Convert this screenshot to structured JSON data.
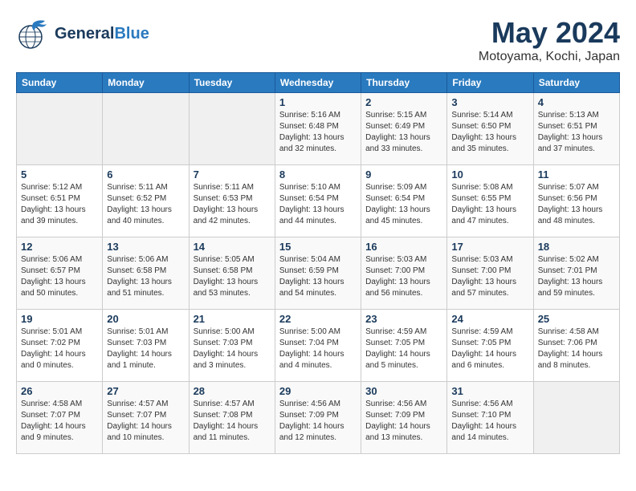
{
  "header": {
    "logo_line1": "General",
    "logo_line2": "Blue",
    "month": "May 2024",
    "location": "Motoyama, Kochi, Japan"
  },
  "weekdays": [
    "Sunday",
    "Monday",
    "Tuesday",
    "Wednesday",
    "Thursday",
    "Friday",
    "Saturday"
  ],
  "weeks": [
    [
      {
        "day": "",
        "info": ""
      },
      {
        "day": "",
        "info": ""
      },
      {
        "day": "",
        "info": ""
      },
      {
        "day": "1",
        "info": "Sunrise: 5:16 AM\nSunset: 6:48 PM\nDaylight: 13 hours\nand 32 minutes."
      },
      {
        "day": "2",
        "info": "Sunrise: 5:15 AM\nSunset: 6:49 PM\nDaylight: 13 hours\nand 33 minutes."
      },
      {
        "day": "3",
        "info": "Sunrise: 5:14 AM\nSunset: 6:50 PM\nDaylight: 13 hours\nand 35 minutes."
      },
      {
        "day": "4",
        "info": "Sunrise: 5:13 AM\nSunset: 6:51 PM\nDaylight: 13 hours\nand 37 minutes."
      }
    ],
    [
      {
        "day": "5",
        "info": "Sunrise: 5:12 AM\nSunset: 6:51 PM\nDaylight: 13 hours\nand 39 minutes."
      },
      {
        "day": "6",
        "info": "Sunrise: 5:11 AM\nSunset: 6:52 PM\nDaylight: 13 hours\nand 40 minutes."
      },
      {
        "day": "7",
        "info": "Sunrise: 5:11 AM\nSunset: 6:53 PM\nDaylight: 13 hours\nand 42 minutes."
      },
      {
        "day": "8",
        "info": "Sunrise: 5:10 AM\nSunset: 6:54 PM\nDaylight: 13 hours\nand 44 minutes."
      },
      {
        "day": "9",
        "info": "Sunrise: 5:09 AM\nSunset: 6:54 PM\nDaylight: 13 hours\nand 45 minutes."
      },
      {
        "day": "10",
        "info": "Sunrise: 5:08 AM\nSunset: 6:55 PM\nDaylight: 13 hours\nand 47 minutes."
      },
      {
        "day": "11",
        "info": "Sunrise: 5:07 AM\nSunset: 6:56 PM\nDaylight: 13 hours\nand 48 minutes."
      }
    ],
    [
      {
        "day": "12",
        "info": "Sunrise: 5:06 AM\nSunset: 6:57 PM\nDaylight: 13 hours\nand 50 minutes."
      },
      {
        "day": "13",
        "info": "Sunrise: 5:06 AM\nSunset: 6:58 PM\nDaylight: 13 hours\nand 51 minutes."
      },
      {
        "day": "14",
        "info": "Sunrise: 5:05 AM\nSunset: 6:58 PM\nDaylight: 13 hours\nand 53 minutes."
      },
      {
        "day": "15",
        "info": "Sunrise: 5:04 AM\nSunset: 6:59 PM\nDaylight: 13 hours\nand 54 minutes."
      },
      {
        "day": "16",
        "info": "Sunrise: 5:03 AM\nSunset: 7:00 PM\nDaylight: 13 hours\nand 56 minutes."
      },
      {
        "day": "17",
        "info": "Sunrise: 5:03 AM\nSunset: 7:00 PM\nDaylight: 13 hours\nand 57 minutes."
      },
      {
        "day": "18",
        "info": "Sunrise: 5:02 AM\nSunset: 7:01 PM\nDaylight: 13 hours\nand 59 minutes."
      }
    ],
    [
      {
        "day": "19",
        "info": "Sunrise: 5:01 AM\nSunset: 7:02 PM\nDaylight: 14 hours\nand 0 minutes."
      },
      {
        "day": "20",
        "info": "Sunrise: 5:01 AM\nSunset: 7:03 PM\nDaylight: 14 hours\nand 1 minute."
      },
      {
        "day": "21",
        "info": "Sunrise: 5:00 AM\nSunset: 7:03 PM\nDaylight: 14 hours\nand 3 minutes."
      },
      {
        "day": "22",
        "info": "Sunrise: 5:00 AM\nSunset: 7:04 PM\nDaylight: 14 hours\nand 4 minutes."
      },
      {
        "day": "23",
        "info": "Sunrise: 4:59 AM\nSunset: 7:05 PM\nDaylight: 14 hours\nand 5 minutes."
      },
      {
        "day": "24",
        "info": "Sunrise: 4:59 AM\nSunset: 7:05 PM\nDaylight: 14 hours\nand 6 minutes."
      },
      {
        "day": "25",
        "info": "Sunrise: 4:58 AM\nSunset: 7:06 PM\nDaylight: 14 hours\nand 8 minutes."
      }
    ],
    [
      {
        "day": "26",
        "info": "Sunrise: 4:58 AM\nSunset: 7:07 PM\nDaylight: 14 hours\nand 9 minutes."
      },
      {
        "day": "27",
        "info": "Sunrise: 4:57 AM\nSunset: 7:07 PM\nDaylight: 14 hours\nand 10 minutes."
      },
      {
        "day": "28",
        "info": "Sunrise: 4:57 AM\nSunset: 7:08 PM\nDaylight: 14 hours\nand 11 minutes."
      },
      {
        "day": "29",
        "info": "Sunrise: 4:56 AM\nSunset: 7:09 PM\nDaylight: 14 hours\nand 12 minutes."
      },
      {
        "day": "30",
        "info": "Sunrise: 4:56 AM\nSunset: 7:09 PM\nDaylight: 14 hours\nand 13 minutes."
      },
      {
        "day": "31",
        "info": "Sunrise: 4:56 AM\nSunset: 7:10 PM\nDaylight: 14 hours\nand 14 minutes."
      },
      {
        "day": "",
        "info": ""
      }
    ]
  ]
}
